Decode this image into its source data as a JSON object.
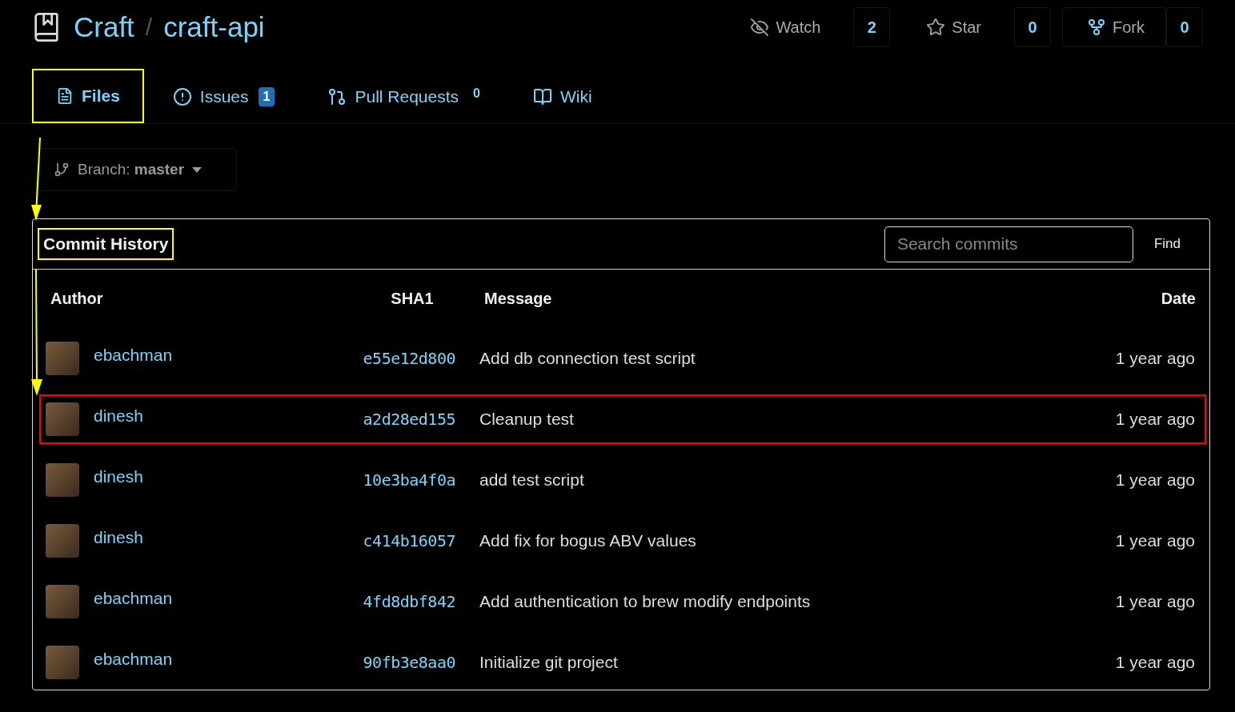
{
  "repo": {
    "owner": "Craft",
    "separator": "/",
    "name": "craft-api"
  },
  "actions": [
    {
      "kind": "watch",
      "label": "Watch",
      "count": "2"
    },
    {
      "kind": "star",
      "label": "Star",
      "count": "0"
    },
    {
      "kind": "fork",
      "label": "Fork",
      "count": "0"
    }
  ],
  "tabs": [
    {
      "kind": "files",
      "label": "Files",
      "selected": true,
      "highlighted": true
    },
    {
      "kind": "issues",
      "label": "Issues",
      "badge": "1",
      "selected": false,
      "highlighted": false
    },
    {
      "kind": "pulls",
      "label": "Pull Requests",
      "count": "0",
      "selected": false,
      "highlighted": false
    },
    {
      "kind": "wiki",
      "label": "Wiki",
      "selected": false,
      "highlighted": false
    }
  ],
  "branch": {
    "label": "Branch:",
    "value": "master"
  },
  "commits": {
    "title": "Commit History",
    "title_highlighted": true,
    "search": {
      "placeholder": "Search commits"
    },
    "find_button": "Find",
    "columns": [
      "Author",
      "SHA1",
      "Message",
      "Date"
    ],
    "rows": [
      {
        "author": "ebachman",
        "sha": "e55e12d800",
        "message": "Add db connection test script",
        "date": "1 year ago",
        "highlighted": false
      },
      {
        "author": "dinesh",
        "sha": "a2d28ed155",
        "message": "Cleanup test",
        "date": "1 year ago",
        "highlighted": true
      },
      {
        "author": "dinesh",
        "sha": "10e3ba4f0a",
        "message": "add test script",
        "date": "1 year ago",
        "highlighted": false
      },
      {
        "author": "dinesh",
        "sha": "c414b16057",
        "message": "Add fix for bogus ABV values",
        "date": "1 year ago",
        "highlighted": false
      },
      {
        "author": "ebachman",
        "sha": "4fd8dbf842",
        "message": "Add authentication to brew modify endpoints",
        "date": "1 year ago",
        "highlighted": false
      },
      {
        "author": "ebachman",
        "sha": "90fb3e8aa0",
        "message": "Initialize git project",
        "date": "1 year ago",
        "highlighted": false
      }
    ]
  }
}
